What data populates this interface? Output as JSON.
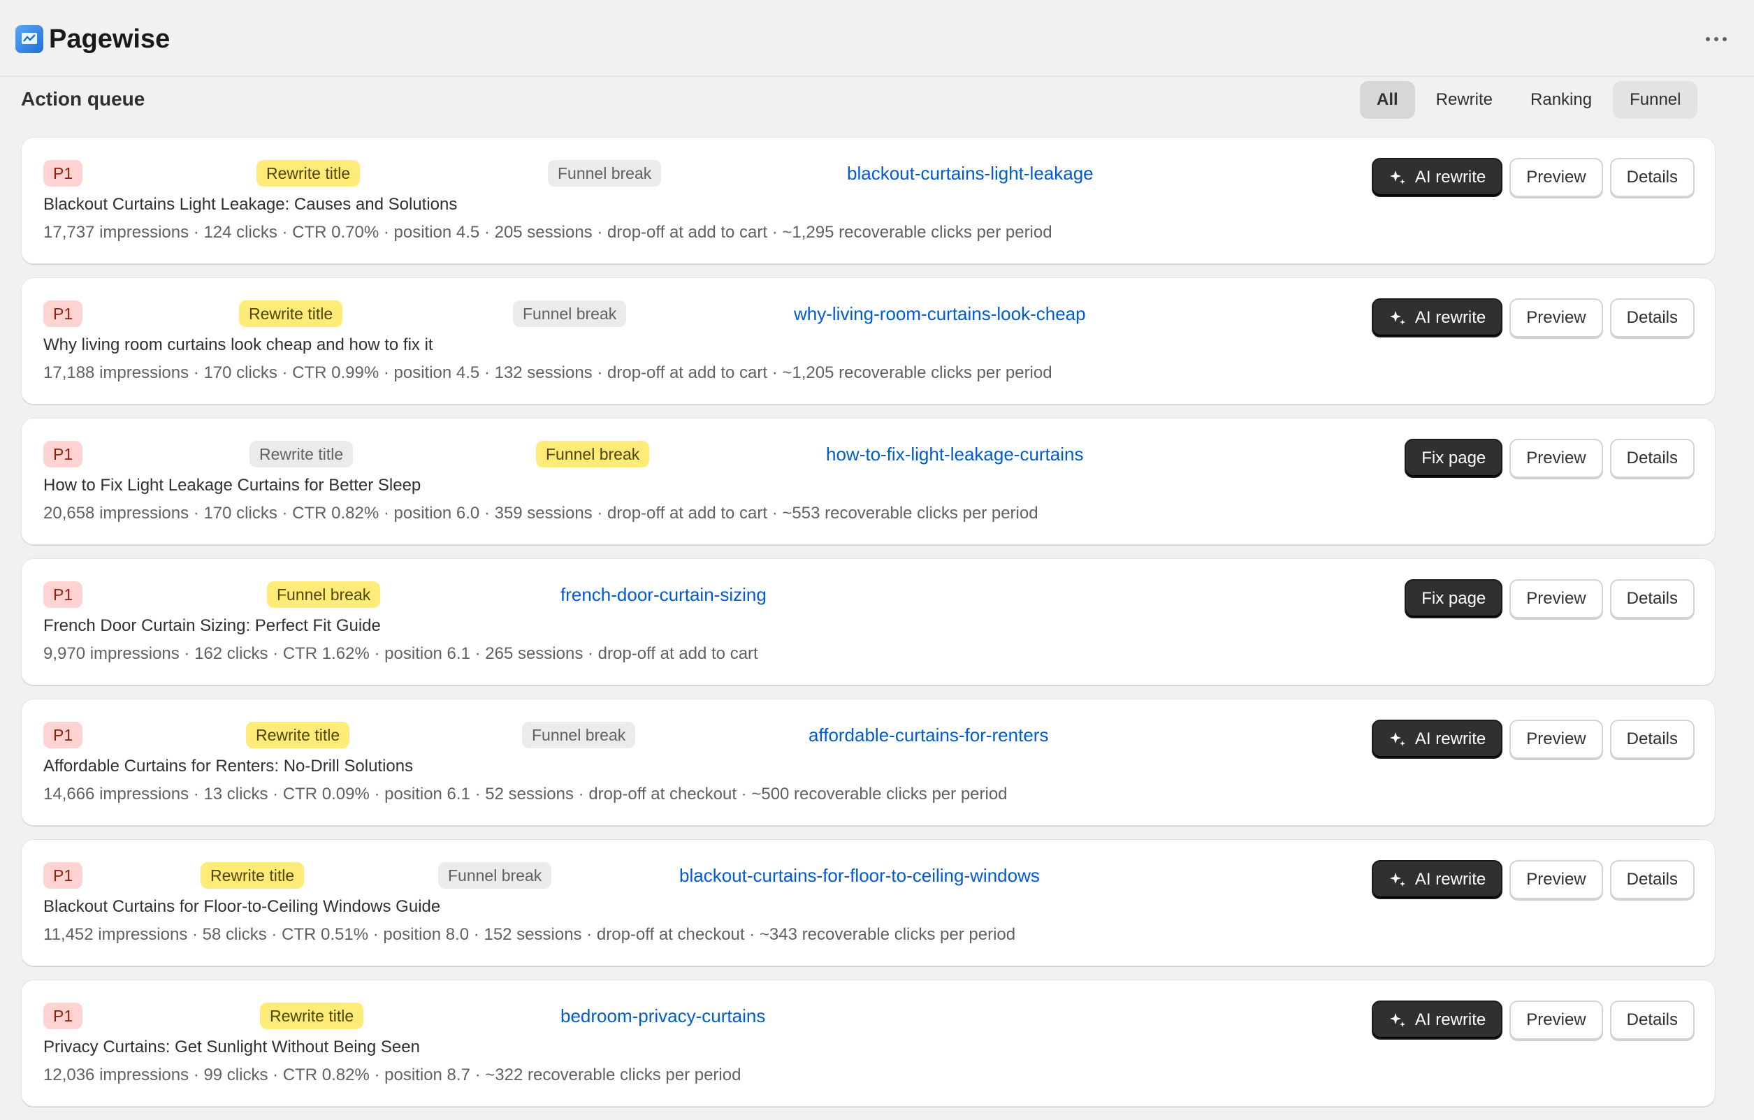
{
  "app": {
    "title": "Pagewise",
    "logo_icon": "pagewise-logo-icon",
    "menu_icon": "more-horizontal-icon"
  },
  "queue": {
    "title": "Action queue",
    "filters": [
      {
        "label": "All",
        "state": "selected"
      },
      {
        "label": "Rewrite",
        "state": ""
      },
      {
        "label": "Ranking",
        "state": ""
      },
      {
        "label": "Funnel",
        "state": "hover"
      }
    ]
  },
  "colors": {
    "priority_bg": "#fed3d1",
    "highlight_bg": "#ffeb78",
    "neutral_bg": "#ebebeb",
    "link": "#005bd3",
    "primary_button": "#303030"
  },
  "items": [
    {
      "priority": "P1",
      "tags": [
        {
          "label": "Rewrite title",
          "style": "warn"
        },
        {
          "label": "Funnel break",
          "style": "neutral"
        }
      ],
      "slug": "blackout-curtains-light-leakage",
      "title": "Blackout Curtains Light Leakage: Causes and Solutions",
      "metrics": "17,737 impressions · 124 clicks · CTR 0.70% · position 4.5 · 205 sessions · drop-off at add to cart · ~1,295 recoverable clicks per period",
      "primary_action": "AI rewrite",
      "primary_icon": "sparkle-icon",
      "preview": "Preview",
      "details": "Details"
    },
    {
      "priority": "P1",
      "tags": [
        {
          "label": "Rewrite title",
          "style": "warn"
        },
        {
          "label": "Funnel break",
          "style": "neutral"
        }
      ],
      "slug": "why-living-room-curtains-look-cheap",
      "title": "Why living room curtains look cheap and how to fix it",
      "metrics": "17,188 impressions · 170 clicks · CTR 0.99% · position 4.5 · 132 sessions · drop-off at add to cart · ~1,205 recoverable clicks per period",
      "primary_action": "AI rewrite",
      "primary_icon": "sparkle-icon",
      "preview": "Preview",
      "details": "Details"
    },
    {
      "priority": "P1",
      "tags": [
        {
          "label": "Rewrite title",
          "style": "neutral"
        },
        {
          "label": "Funnel break",
          "style": "warn"
        }
      ],
      "slug": "how-to-fix-light-leakage-curtains",
      "title": "How to Fix Light Leakage Curtains for Better Sleep",
      "metrics": "20,658 impressions · 170 clicks · CTR 0.82% · position 6.0 · 359 sessions · drop-off at add to cart · ~553 recoverable clicks per period",
      "primary_action": "Fix page",
      "primary_icon": "",
      "preview": "Preview",
      "details": "Details"
    },
    {
      "priority": "P1",
      "tags": [
        {
          "label": "Funnel break",
          "style": "warn"
        }
      ],
      "slug": "french-door-curtain-sizing",
      "title": "French Door Curtain Sizing: Perfect Fit Guide",
      "metrics": "9,970 impressions · 162 clicks · CTR 1.62% · position 6.1 · 265 sessions · drop-off at add to cart",
      "primary_action": "Fix page",
      "primary_icon": "",
      "preview": "Preview",
      "details": "Details"
    },
    {
      "priority": "P1",
      "tags": [
        {
          "label": "Rewrite title",
          "style": "warn"
        },
        {
          "label": "Funnel break",
          "style": "neutral"
        }
      ],
      "slug": "affordable-curtains-for-renters",
      "title": "Affordable Curtains for Renters: No-Drill Solutions",
      "metrics": "14,666 impressions · 13 clicks · CTR 0.09% · position 6.1 · 52 sessions · drop-off at checkout · ~500 recoverable clicks per period",
      "primary_action": "AI rewrite",
      "primary_icon": "sparkle-icon",
      "preview": "Preview",
      "details": "Details"
    },
    {
      "priority": "P1",
      "tags": [
        {
          "label": "Rewrite title",
          "style": "warn"
        },
        {
          "label": "Funnel break",
          "style": "neutral"
        }
      ],
      "slug": "blackout-curtains-for-floor-to-ceiling-windows",
      "title": "Blackout Curtains for Floor-to-Ceiling Windows Guide",
      "metrics": "11,452 impressions · 58 clicks · CTR 0.51% · position 8.0 · 152 sessions · drop-off at checkout · ~343 recoverable clicks per period",
      "primary_action": "AI rewrite",
      "primary_icon": "sparkle-icon",
      "preview": "Preview",
      "details": "Details"
    },
    {
      "priority": "P1",
      "tags": [
        {
          "label": "Rewrite title",
          "style": "warn"
        }
      ],
      "slug": "bedroom-privacy-curtains",
      "title": "Privacy Curtains: Get Sunlight Without Being Seen",
      "metrics": "12,036 impressions · 99 clicks · CTR 0.82% · position 8.7 · ~322 recoverable clicks per period",
      "primary_action": "AI rewrite",
      "primary_icon": "sparkle-icon",
      "preview": "Preview",
      "details": "Details"
    }
  ]
}
